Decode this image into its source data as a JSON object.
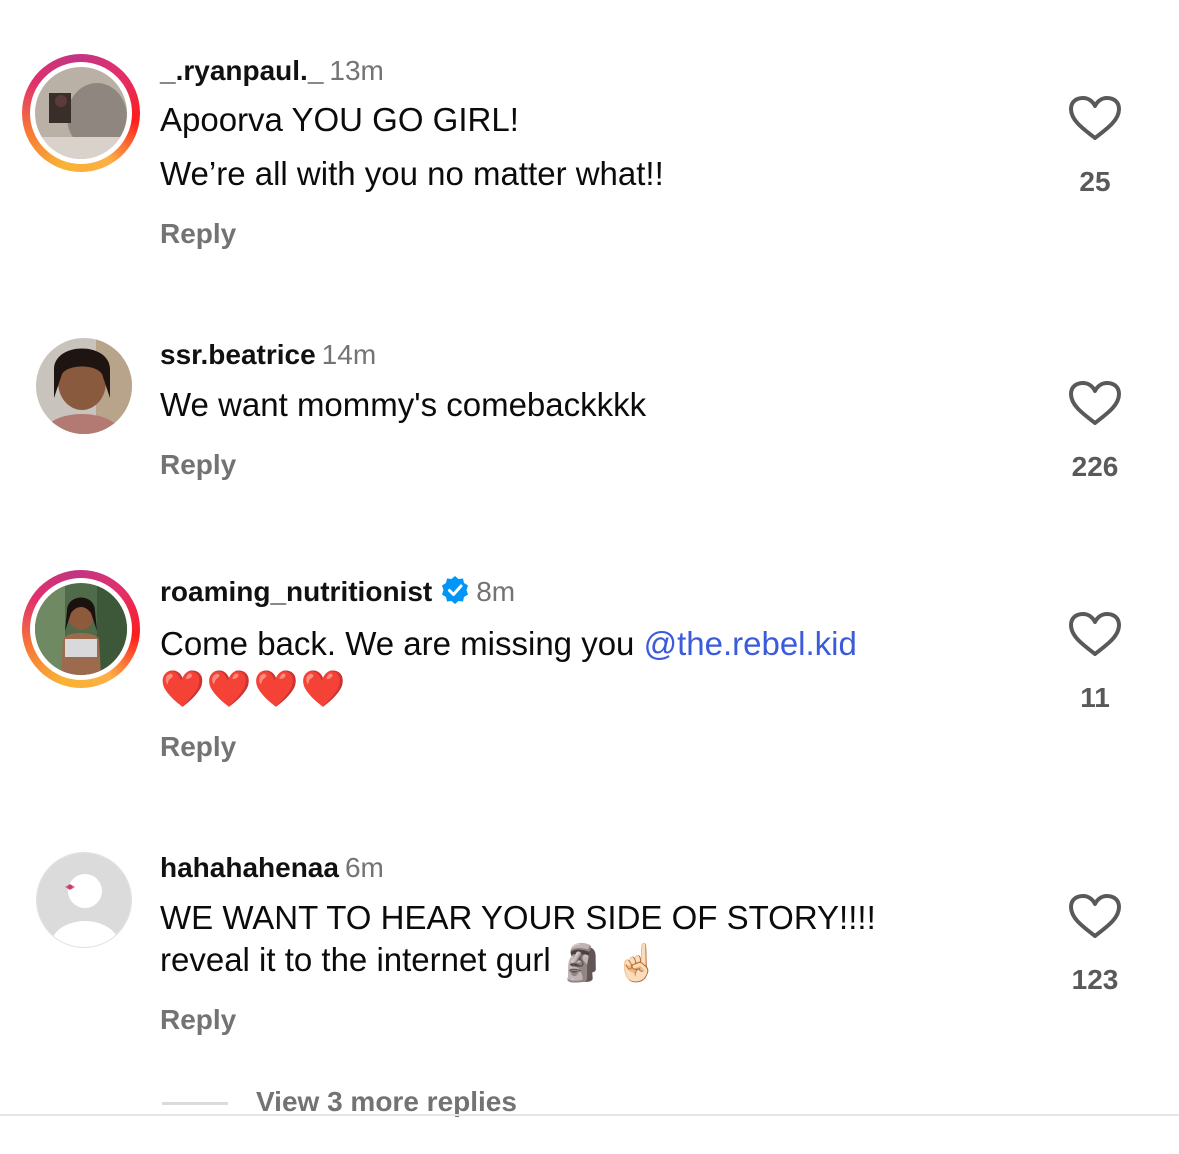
{
  "comments": [
    {
      "username": "_.ryanpaul._",
      "time": "13m",
      "line1": "Apoorva YOU GO GIRL!",
      "line2": "We’re all with you no matter what!!",
      "reply": "Reply",
      "likes": "25",
      "has_story_ring": true
    },
    {
      "username": "ssr.beatrice",
      "time": "14m",
      "line1": "We want mommy's comebackkkk",
      "reply": "Reply",
      "likes": "226",
      "has_story_ring": false
    },
    {
      "username": "roaming_nutritionist",
      "time": "8m",
      "verified": true,
      "line1": "Come back. We are missing you",
      "mention": "@the.rebel.kid",
      "line2": "❤️❤️❤️❤️",
      "reply": "Reply",
      "likes": "11",
      "has_story_ring": true
    },
    {
      "username": "hahahahenaa",
      "time": "6m",
      "line1": "WE WANT TO HEAR YOUR SIDE OF STORY!!!!",
      "line2": "reveal it to the internet gurl",
      "line2_emoji": "🗿 ☝🏻",
      "reply": "Reply",
      "likes": "123",
      "has_story_ring": false
    }
  ],
  "view_more": "View 3 more replies",
  "colors": {
    "mention": "#3b5bdb",
    "verified": "#0095f6",
    "secondary_text": "#737373"
  }
}
